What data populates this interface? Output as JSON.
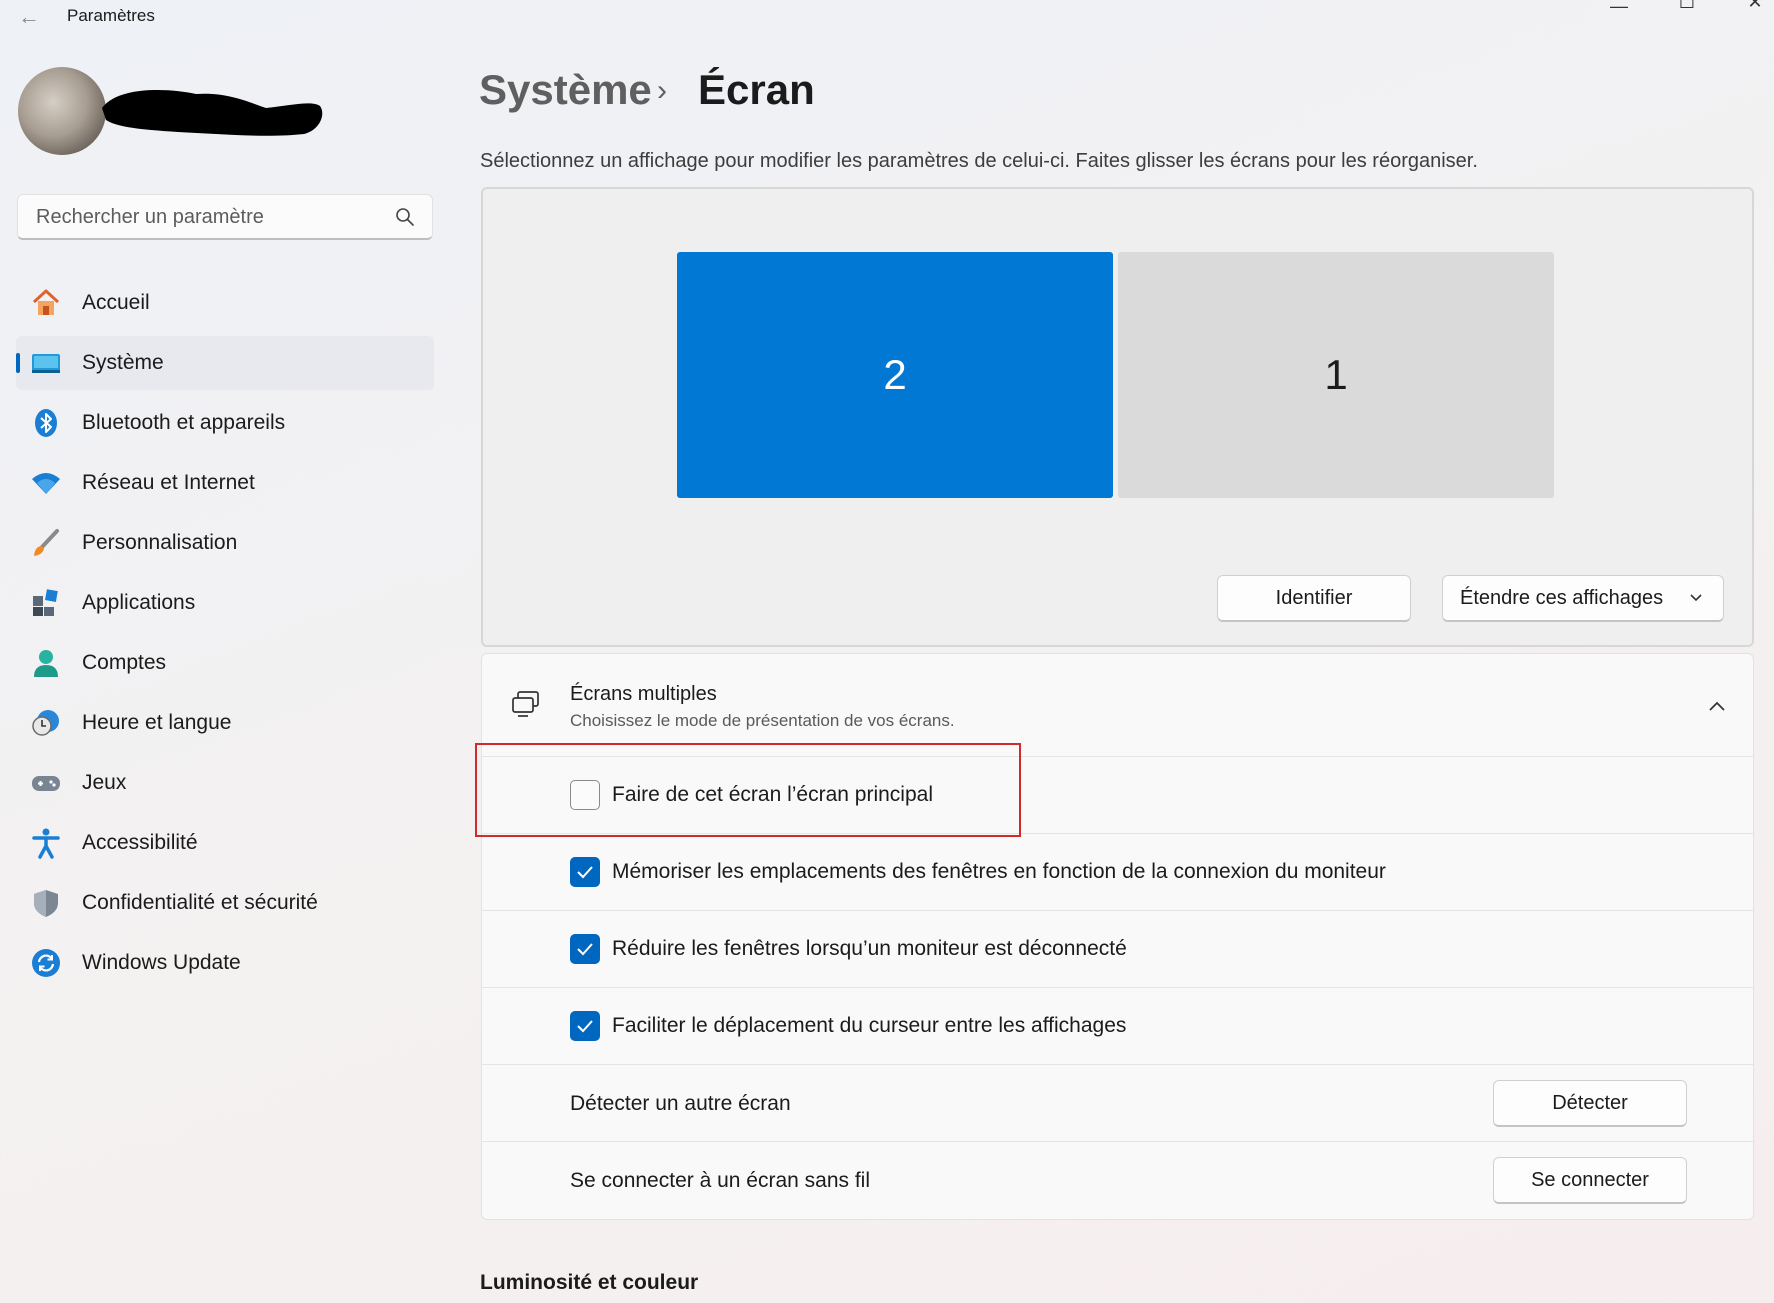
{
  "window": {
    "title": "Paramètres",
    "back_glyph": "←",
    "minimize_glyph": "—",
    "maximize_glyph": "☐",
    "close_glyph": "✕"
  },
  "search": {
    "placeholder": "Rechercher un paramètre"
  },
  "nav": [
    {
      "label": "Accueil",
      "icon": "home-icon"
    },
    {
      "label": "Système",
      "icon": "system-icon",
      "selected": true
    },
    {
      "label": "Bluetooth et appareils",
      "icon": "bluetooth-icon"
    },
    {
      "label": "Réseau et Internet",
      "icon": "wifi-icon"
    },
    {
      "label": "Personnalisation",
      "icon": "brush-icon"
    },
    {
      "label": "Applications",
      "icon": "apps-icon"
    },
    {
      "label": "Comptes",
      "icon": "account-icon"
    },
    {
      "label": "Heure et langue",
      "icon": "clock-globe-icon"
    },
    {
      "label": "Jeux",
      "icon": "gamepad-icon"
    },
    {
      "label": "Accessibilité",
      "icon": "accessibility-icon"
    },
    {
      "label": "Confidentialité et sécurité",
      "icon": "shield-icon"
    },
    {
      "label": "Windows Update",
      "icon": "update-icon"
    }
  ],
  "header": {
    "parent": "Système",
    "separator": "›",
    "current": "Écran",
    "subtitle": "Sélectionnez un affichage pour modifier les paramètres de celui-ci. Faites glisser les écrans pour les réorganiser."
  },
  "arrangement": {
    "monitors": [
      {
        "number": "2",
        "selected": true
      },
      {
        "number": "1",
        "selected": false
      }
    ],
    "identify_label": "Identifier",
    "mode_label": "Étendre ces affichages"
  },
  "multiple_displays": {
    "title": "Écrans multiples",
    "description": "Choisissez le mode de présentation de vos écrans.",
    "options": [
      {
        "label": "Faire de cet écran l’écran principal",
        "checked": false
      },
      {
        "label": "Mémoriser les emplacements des fenêtres en fonction de la connexion du moniteur",
        "checked": true
      },
      {
        "label": "Réduire les fenêtres lorsqu’un moniteur est déconnecté",
        "checked": true
      },
      {
        "label": "Faciliter le déplacement du curseur entre les affichages",
        "checked": true
      }
    ],
    "detect": {
      "label": "Détecter un autre écran",
      "button": "Détecter"
    },
    "wireless": {
      "label": "Se connecter à un écran sans fil",
      "button": "Se connecter"
    }
  },
  "next_section": "Luminosité et couleur",
  "colors": {
    "accent": "#0078d4",
    "highlight_box": "#d22a2a"
  }
}
